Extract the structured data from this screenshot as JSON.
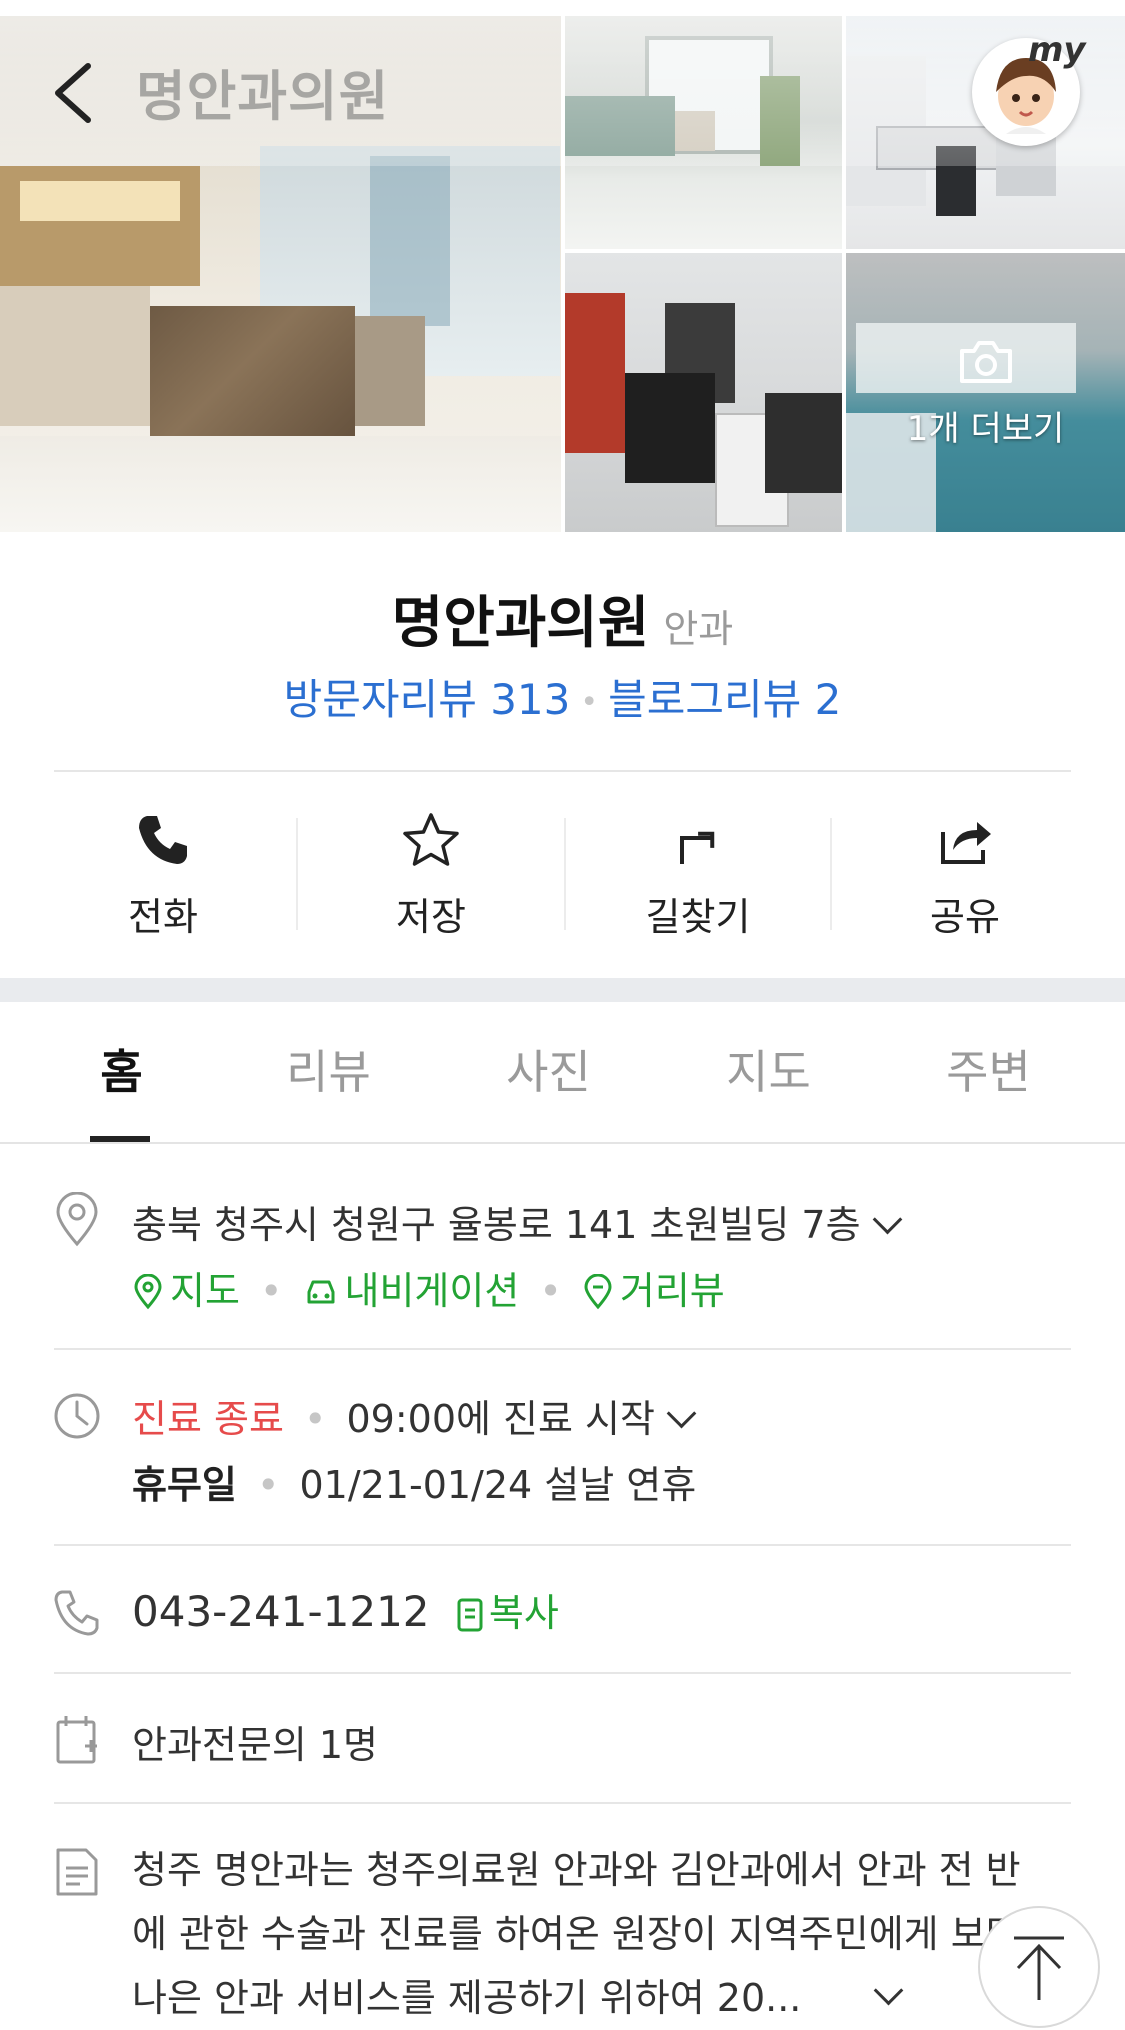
{
  "header": {
    "title": "명안과의원",
    "my_label": "my",
    "more_photos_label": "1개 더보기"
  },
  "place": {
    "name": "명안과의원",
    "category": "안과",
    "visitor_reviews": "방문자리뷰 313",
    "blog_reviews": "블로그리뷰 2"
  },
  "actions": [
    {
      "label": "전화",
      "icon": "phone-icon"
    },
    {
      "label": "저장",
      "icon": "star-icon"
    },
    {
      "label": "길찾기",
      "icon": "directions-icon"
    },
    {
      "label": "공유",
      "icon": "share-icon"
    }
  ],
  "tabs": [
    {
      "label": "홈",
      "active": true
    },
    {
      "label": "리뷰",
      "active": false
    },
    {
      "label": "사진",
      "active": false
    },
    {
      "label": "지도",
      "active": false
    },
    {
      "label": "주변",
      "active": false
    }
  ],
  "info": {
    "address": "충북 청주시 청원구 율봉로 141 초원빌딩 7층",
    "map_link": "지도",
    "navigation_link": "내비게이션",
    "streetview_link": "거리뷰",
    "status": "진료 종료",
    "next_open": "09:00에 진료 시작",
    "holiday_label": "휴무일",
    "holiday_value": "01/21-01/24 설날 연휴",
    "phone": "043-241-1212",
    "copy_label": "복사",
    "doctors": "안과전문의 1명",
    "description_line1": "청주 명안과는 청주의료원 안과와 김안과에서 안과 전 반",
    "description_line2": "에 관한 수술과 진료를 하여온 원장이 지역주민에게 보다",
    "description_line3": "나은 안과 서비스를 제공하기 위하여 20..."
  },
  "colors": {
    "link_blue": "#2b6fd1",
    "green": "#23a334",
    "closed_red": "#e64b4b"
  }
}
